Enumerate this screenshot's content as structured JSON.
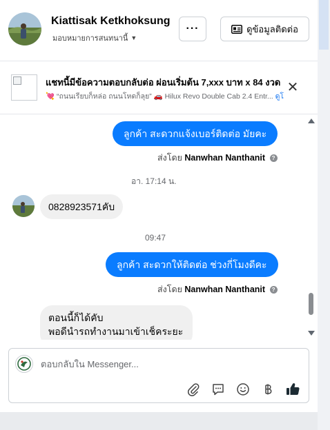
{
  "header": {
    "contact_name": "Kiattisak Ketkhoksung",
    "assignee_label": "มอบหมายการสนทนานี้",
    "more_label": "···",
    "contact_button_label": "ดูข้อมูลติดต่อ"
  },
  "ad": {
    "title": "แชทนี้มีข้อความตอบกลับต่อ ผ่อนเริ่มต้น 7,xxx บาท x 84 งวด",
    "subtitle_emoji": "💘",
    "subtitle_text": "“ถนนเรียบก็หล่อ ถนนโหดก็ลุย”",
    "subtitle_car_emoji": "🚗",
    "subtitle_model": "Hilux Revo Double Cab 2.4 Entr...",
    "subtitle_link": "ดูโ"
  },
  "messages": {
    "out1": "ลูกค้า  สะดวกแจ้งเบอร์ติดต่อ มัยคะ",
    "sentby_prefix": "ส่งโดย",
    "sentby_name": "Nanwhan Nanthanit",
    "time1": "อา. 17:14 น.",
    "in1": "0828923571คับ",
    "time2": "09:47",
    "out2": "ลูกค้า  สะดวกให้ติดต่อ ช่วงกี่โมงดีคะ",
    "in2_line1": "ตอนนี้ก็ได้คับ",
    "in2_line2": "พอดีนำรถทำงานมาเข้าเช็คระยะ"
  },
  "composer": {
    "placeholder": "ตอบกลับใน Messenger..."
  },
  "colors": {
    "accent": "#0a7cff",
    "incoming_bubble": "#f0f0f0",
    "muted_text": "#65676b"
  },
  "icons": [
    "more-icon",
    "contact-card-icon",
    "close-icon",
    "attachment-icon",
    "saved-reply-icon",
    "emoji-icon",
    "baht-icon",
    "like-icon"
  ]
}
